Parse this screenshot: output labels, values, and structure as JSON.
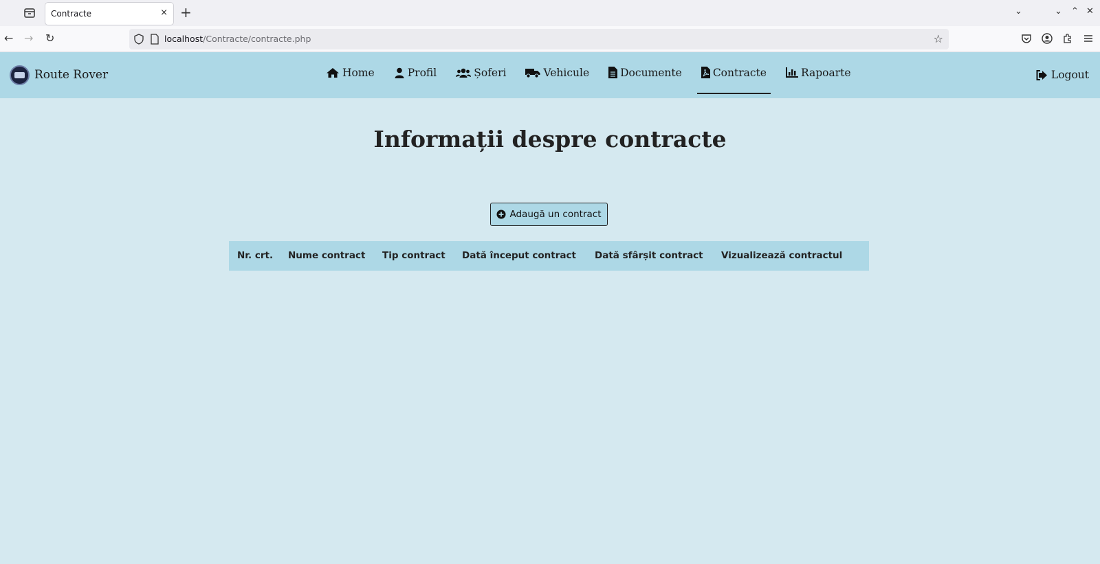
{
  "browser": {
    "tab_title": "Contracte",
    "tab_close": "×",
    "new_tab": "+",
    "url_host": "localhost",
    "url_path": "/Contracte/contracte.php",
    "back": "←",
    "forward": "→",
    "reload": "↻",
    "star": "☆",
    "win_list": "⌄",
    "win_min": "⌄",
    "win_max": "⌃",
    "win_close": "✕"
  },
  "site": {
    "brand": "Route Rover",
    "nav": [
      {
        "label": "Home",
        "icon": "home-icon"
      },
      {
        "label": "Profil",
        "icon": "user-icon"
      },
      {
        "label": "Șoferi",
        "icon": "users-icon"
      },
      {
        "label": "Vehicule",
        "icon": "truck-icon"
      },
      {
        "label": "Documente",
        "icon": "file-icon"
      },
      {
        "label": "Contracte",
        "icon": "file-pdf-icon",
        "active": true
      },
      {
        "label": "Rapoarte",
        "icon": "chart-icon"
      }
    ],
    "logout": "Logout"
  },
  "main": {
    "title": "Informații despre contracte",
    "add_button": "Adaugă un contract",
    "table_headers": [
      "Nr. crt.",
      "Nume contract",
      "Tip contract",
      "Dată început contract",
      "Dată sfârșit contract",
      "Vizualizează contractul"
    ]
  }
}
